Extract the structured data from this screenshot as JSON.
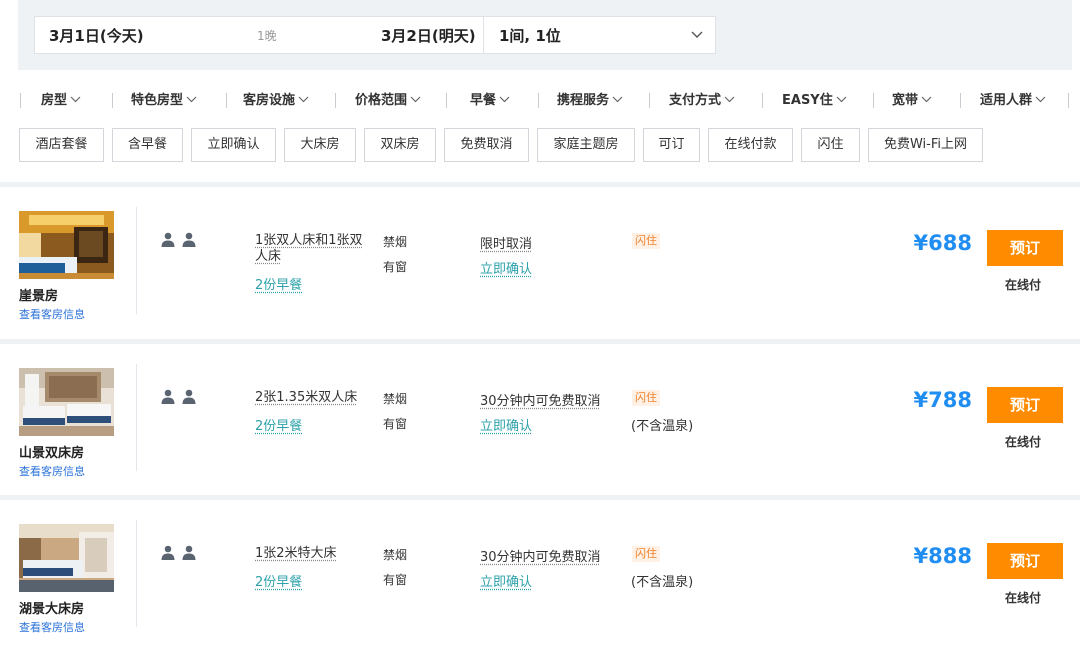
{
  "search": {
    "checkin": "3月1日(今天)",
    "nights": "1晚",
    "checkout": "3月2日(明天)",
    "guests": "1间, 1位"
  },
  "filters": [
    "房型",
    "特色房型",
    "客房设施",
    "价格范围",
    "早餐",
    "携程服务",
    "支付方式",
    "EASY住",
    "宽带",
    "适用人群"
  ],
  "tags": [
    "酒店套餐",
    "含早餐",
    "立即确认",
    "大床房",
    "双床房",
    "免费取消",
    "家庭主题房",
    "可订",
    "在线付款",
    "闪住",
    "免费Wi-Fi上网"
  ],
  "rooms": [
    {
      "name": "崖景房",
      "info_link": "查看客房信息",
      "bed": "1张双人床和1张双人床",
      "breakfast": "2份早餐",
      "smoking": "禁烟",
      "window": "有窗",
      "cancel": "限时取消",
      "confirm": "立即确认",
      "badge": "闪住",
      "note": "",
      "price": "¥688",
      "book_label": "预订",
      "pay_note": "在线付"
    },
    {
      "name": "山景双床房",
      "info_link": "查看客房信息",
      "bed": "2张1.35米双人床",
      "breakfast": "2份早餐",
      "smoking": "禁烟",
      "window": "有窗",
      "cancel": "30分钟内可免费取消",
      "confirm": "立即确认",
      "badge": "闪住",
      "note": "(不含温泉)",
      "price": "¥788",
      "book_label": "预订",
      "pay_note": "在线付"
    },
    {
      "name": "湖景大床房",
      "info_link": "查看客房信息",
      "bed": "1张2米特大床",
      "breakfast": "2份早餐",
      "smoking": "禁烟",
      "window": "有窗",
      "cancel": "30分钟内可免费取消",
      "confirm": "立即确认",
      "badge": "闪住",
      "note": "(不含温泉)",
      "price": "¥888",
      "book_label": "预订",
      "pay_note": "在线付"
    }
  ],
  "colors": {
    "accent_blue": "#1f8df2",
    "link_teal": "#2ca1a9",
    "book_orange": "#ff8b00",
    "badge_orange": "#f0822c"
  },
  "icons": [
    "chevron-down-icon",
    "person-icon"
  ]
}
